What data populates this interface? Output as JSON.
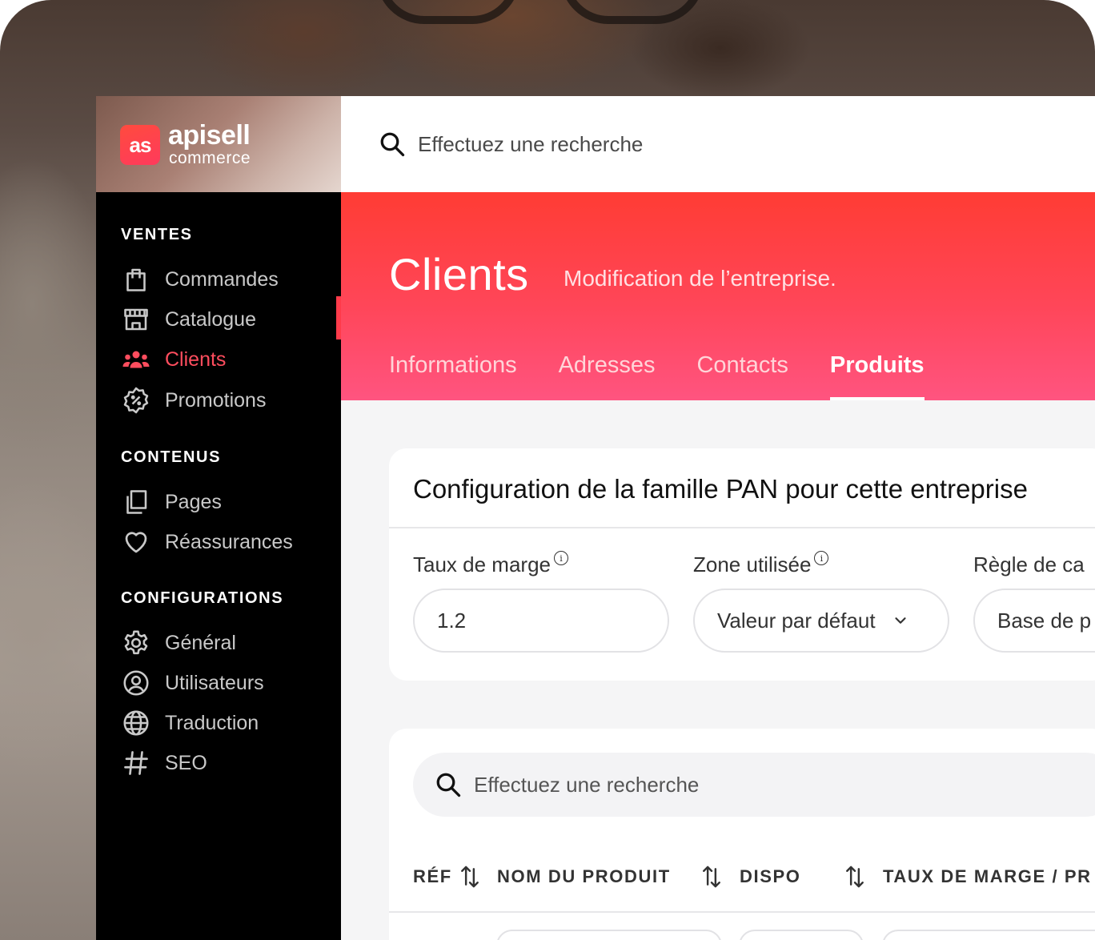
{
  "brand": {
    "logo_mark": "as",
    "name": "apisell",
    "subtitle": "commerce",
    "accent_color": "#ff3b4a"
  },
  "sidebar": {
    "sections": [
      {
        "title": "VENTES",
        "items": [
          {
            "label": "Commandes",
            "icon": "shopping-bag-icon"
          },
          {
            "label": "Catalogue",
            "icon": "store-icon"
          },
          {
            "label": "Clients",
            "icon": "users-icon",
            "active": true
          },
          {
            "label": "Promotions",
            "icon": "discount-badge-icon"
          }
        ]
      },
      {
        "title": "CONTENUS",
        "items": [
          {
            "label": "Pages",
            "icon": "pages-icon"
          },
          {
            "label": "Réassurances",
            "icon": "heart-icon"
          }
        ]
      },
      {
        "title": "CONFIGURATIONS",
        "items": [
          {
            "label": "Général",
            "icon": "gear-icon"
          },
          {
            "label": "Utilisateurs",
            "icon": "user-circle-icon"
          },
          {
            "label": "Traduction",
            "icon": "globe-icon"
          },
          {
            "label": "SEO",
            "icon": "hash-icon"
          }
        ]
      }
    ]
  },
  "topbar": {
    "search_placeholder": "Effectuez une recherche"
  },
  "header": {
    "title": "Clients",
    "subtitle": "Modification de l’entreprise.",
    "tabs": [
      {
        "label": "Informations"
      },
      {
        "label": "Adresses"
      },
      {
        "label": "Contacts"
      },
      {
        "label": "Produits",
        "active": true
      }
    ]
  },
  "config_card": {
    "title": "Configuration de la famille PAN pour cette entreprise",
    "fields": [
      {
        "label": "Taux de marge",
        "value": "1.2",
        "info": "i"
      },
      {
        "label": "Zone utilisée",
        "value": "Valeur par défaut",
        "info": "i"
      },
      {
        "label": "Règle de ca",
        "value": "Base de p"
      }
    ]
  },
  "products_table": {
    "search_placeholder": "Effectuez une recherche",
    "columns": [
      "RÉF",
      "NOM DU PRODUIT",
      "DISPO",
      "TAUX DE MARGE / PR"
    ]
  }
}
